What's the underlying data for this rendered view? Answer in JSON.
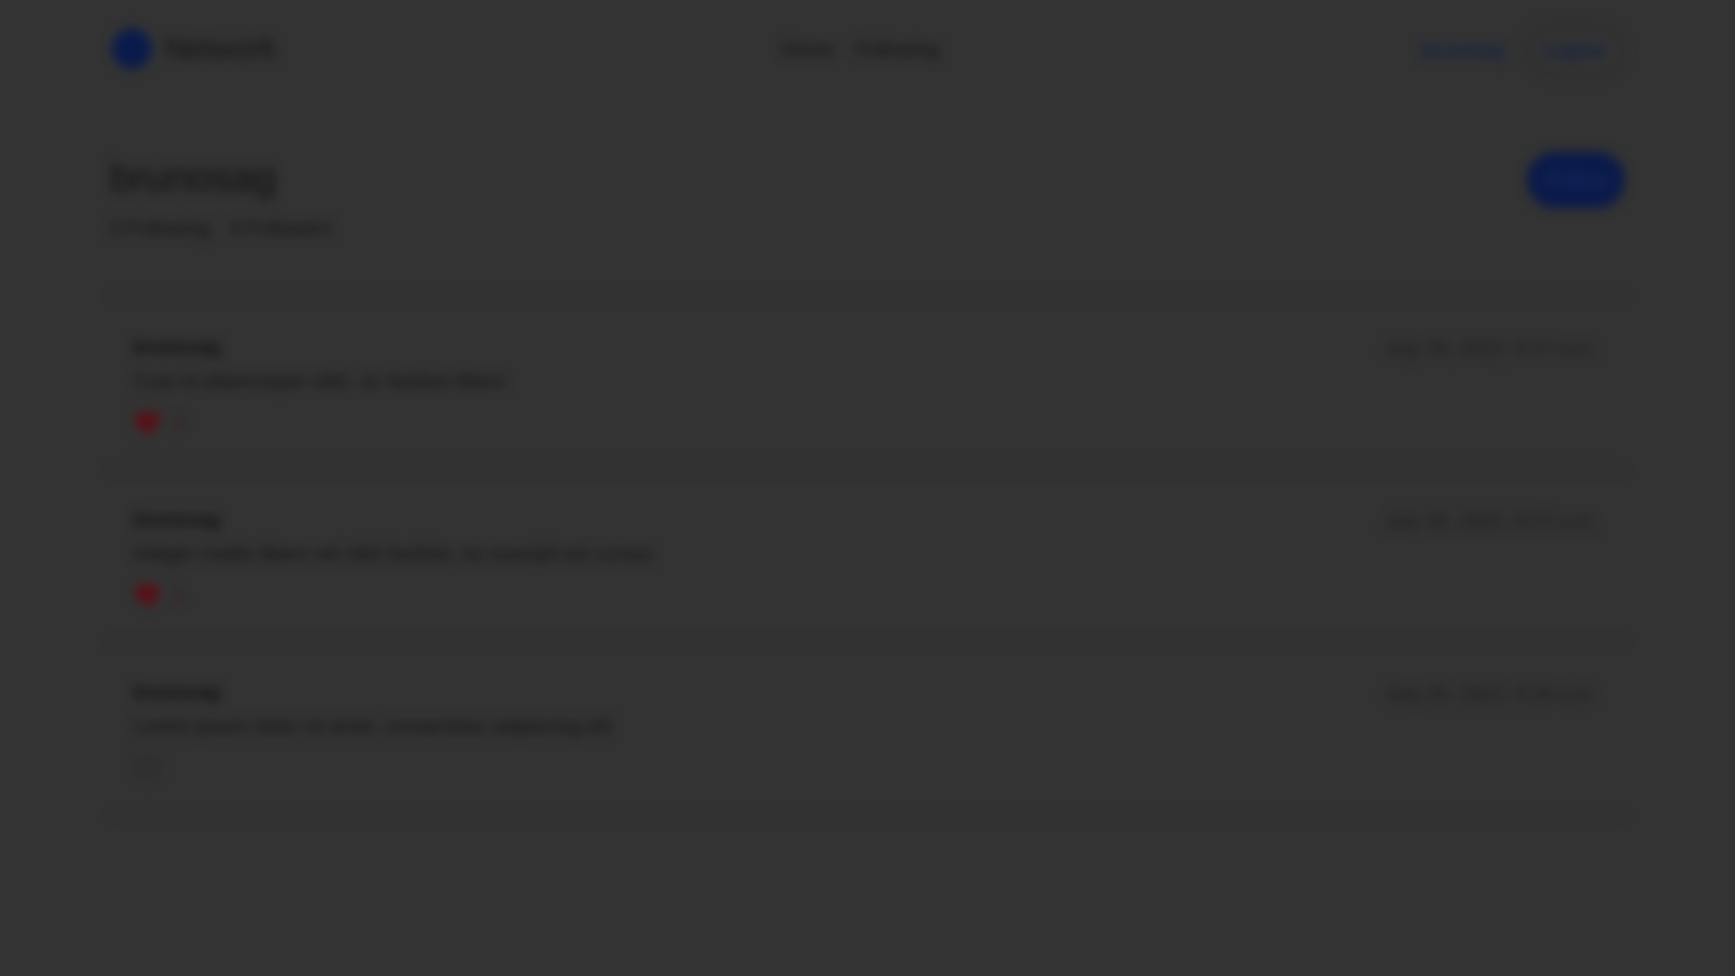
{
  "header": {
    "brand": "Network",
    "nav": [
      {
        "label": "Home"
      },
      {
        "label": "Following"
      }
    ],
    "username": "brunosag",
    "logout_label": "Logout"
  },
  "profile": {
    "name": "brunosag",
    "following_count": "5",
    "following_label": "Following",
    "followers_count": "8",
    "followers_label": "Followers",
    "follow_label": "Follow"
  },
  "posts": [
    {
      "author": "brunosag",
      "body": "Cras id ullamcorper nibh, ac facilisis libero",
      "timestamp": "July 26, 2022, 5:27 a.m.",
      "likes": "2",
      "liked": true
    },
    {
      "author": "brunosag",
      "body": "Integer mattis libero vel nibh facilisis, eu suscipit est cursus",
      "timestamp": "July 26, 2022, 5:27 a.m.",
      "likes": "1",
      "liked": true
    },
    {
      "author": "brunosag",
      "body": "Lorem ipsum dolor sit amet, consectetur adipiscing elit",
      "timestamp": "July 26, 2022, 5:26 a.m.",
      "likes": "",
      "liked": false
    }
  ],
  "colors": {
    "background": "#333333",
    "accent": "#0a1a4a",
    "like": "#5a0e16"
  }
}
